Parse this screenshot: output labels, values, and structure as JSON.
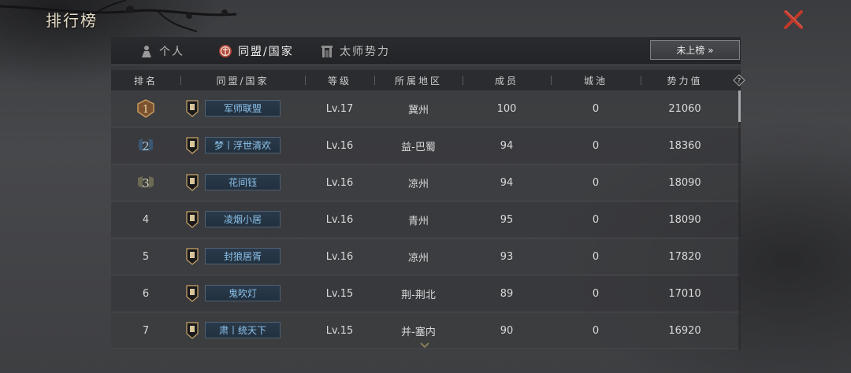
{
  "window": {
    "title": "排行榜"
  },
  "tabs": [
    {
      "label": "个人",
      "icon": "person-icon",
      "active": false
    },
    {
      "label": "同盟/国家",
      "icon": "alliance-crest-icon",
      "active": true
    },
    {
      "label": "太师势力",
      "icon": "gate-icon",
      "active": false
    }
  ],
  "unranked_button": {
    "label": "未上榜 »"
  },
  "columns": [
    "排名",
    "同盟/国家",
    "等级",
    "所属地区",
    "成员",
    "城池",
    "势力值"
  ],
  "rows": [
    {
      "rank": "1",
      "name": "军师联盟",
      "level": "Lv.17",
      "region": "冀州",
      "members": "100",
      "cities": "0",
      "power": "21060"
    },
    {
      "rank": "2",
      "name": "梦丨浮世清欢",
      "level": "Lv.16",
      "region": "益-巴蜀",
      "members": "94",
      "cities": "0",
      "power": "18360"
    },
    {
      "rank": "3",
      "name": "花间钰",
      "level": "Lv.16",
      "region": "凉州",
      "members": "94",
      "cities": "0",
      "power": "18090"
    },
    {
      "rank": "4",
      "name": "凌烟小居",
      "level": "Lv.16",
      "region": "青州",
      "members": "95",
      "cities": "0",
      "power": "18090"
    },
    {
      "rank": "5",
      "name": "封狼居胥",
      "level": "Lv.16",
      "region": "凉州",
      "members": "93",
      "cities": "0",
      "power": "17820"
    },
    {
      "rank": "6",
      "name": "鬼吹灯",
      "level": "Lv.15",
      "region": "荆-荆北",
      "members": "89",
      "cities": "0",
      "power": "17010"
    },
    {
      "rank": "7",
      "name": "肃丨统天下",
      "level": "Lv.15",
      "region": "并-塞内",
      "members": "90",
      "cities": "0",
      "power": "16920"
    }
  ],
  "colors": {
    "gold_rank": "#c89a5c",
    "silver_rank": "#8fb7d8",
    "bronze_rank": "#b9b79a",
    "name_text": "#8cc3ec",
    "close": "#c0392b"
  }
}
